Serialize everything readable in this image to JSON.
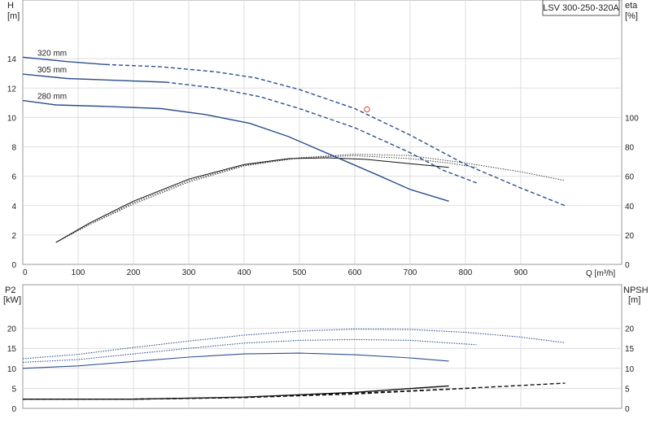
{
  "chart_data": [
    {
      "type": "line",
      "panel": "head-efficiency",
      "title": "LSV 300-250-320A",
      "ylabel": "H",
      "yunit": "[m]",
      "y2label": "eta",
      "y2unit": "[%]",
      "xlabel": "Q [m³/h]",
      "xlim": [
        0,
        1000
      ],
      "ylim": [
        0,
        16
      ],
      "y2lim": [
        0,
        140
      ],
      "xticks": [
        "0",
        "100",
        "200",
        "300",
        "400",
        "500",
        "600",
        "700",
        "800",
        "900"
      ],
      "yticks": [
        "0",
        "2",
        "4",
        "6",
        "8",
        "10",
        "12",
        "14"
      ],
      "y2ticks": [
        "0",
        "20",
        "40",
        "60",
        "80",
        "100"
      ],
      "grid": true,
      "head_curves": [
        {
          "name": "320 mm",
          "color": "#2b4f8f",
          "solid": [
            [
              0,
              14.1
            ],
            [
              80,
              13.8
            ],
            [
              150,
              13.6
            ]
          ],
          "dashed": [
            [
              150,
              13.6
            ],
            [
              250,
              13.45
            ],
            [
              350,
              13.1
            ],
            [
              420,
              12.7
            ],
            [
              500,
              11.9
            ],
            [
              600,
              10.6
            ],
            [
              700,
              8.8
            ],
            [
              800,
              6.8
            ],
            [
              900,
              5.2
            ],
            [
              980,
              4.0
            ]
          ]
        },
        {
          "name": "305 mm",
          "color": "#2b4f8f",
          "solid": [
            [
              0,
              12.95
            ],
            [
              80,
              12.65
            ],
            [
              150,
              12.55
            ],
            [
              258,
              12.4
            ]
          ],
          "dashed": [
            [
              258,
              12.4
            ],
            [
              350,
              12.0
            ],
            [
              430,
              11.4
            ],
            [
              500,
              10.6
            ],
            [
              600,
              9.3
            ],
            [
              700,
              7.6
            ],
            [
              760,
              6.4
            ],
            [
              820,
              5.55
            ]
          ]
        },
        {
          "name": "280 mm",
          "color": "#2b4f8f",
          "solid": [
            [
              0,
              11.15
            ],
            [
              60,
              10.85
            ],
            [
              150,
              10.75
            ],
            [
              250,
              10.6
            ],
            [
              330,
              10.2
            ],
            [
              410,
              9.6
            ],
            [
              480,
              8.7
            ],
            [
              560,
              7.4
            ],
            [
              640,
              6.1
            ],
            [
              700,
              5.1
            ],
            [
              770,
              4.3
            ]
          ]
        }
      ],
      "efficiency_curves": [
        {
          "name": "eta 320 mm",
          "style": "dotted",
          "color": "#444444",
          "points": [
            [
              60,
              15
            ],
            [
              120,
              27
            ],
            [
              200,
              41
            ],
            [
              300,
              56
            ],
            [
              400,
              67
            ],
            [
              500,
              72.5
            ],
            [
              600,
              75
            ],
            [
              700,
              74
            ],
            [
              800,
              69
            ],
            [
              900,
              63
            ],
            [
              980,
              57
            ]
          ]
        },
        {
          "name": "eta 305 mm",
          "style": "dotted",
          "color": "#444444",
          "points": [
            [
              60,
              15
            ],
            [
              120,
              27
            ],
            [
              200,
              42
            ],
            [
              300,
              57
            ],
            [
              400,
              67.5
            ],
            [
              500,
              72.5
            ],
            [
              600,
              74
            ],
            [
              700,
              72
            ],
            [
              770,
              69
            ],
            [
              820,
              66
            ]
          ]
        },
        {
          "name": "eta 280 mm",
          "style": "solid",
          "color": "#111111",
          "points": [
            [
              60,
              15
            ],
            [
              120,
              28
            ],
            [
              200,
              43
            ],
            [
              300,
              58
            ],
            [
              400,
              68
            ],
            [
              480,
              72
            ],
            [
              550,
              72.5
            ],
            [
              620,
              71.5
            ],
            [
              700,
              68.5
            ],
            [
              770,
              66
            ]
          ]
        }
      ],
      "duty_point": {
        "x": 622,
        "y": 10.55,
        "color": "#e23b3b"
      },
      "curve_labels": [
        "320 mm",
        "305 mm",
        "280 mm"
      ]
    },
    {
      "type": "line",
      "panel": "power-npsh",
      "ylabel": "P2",
      "yunit": "[kW]",
      "y2label": "NPSH",
      "y2unit": "[m]",
      "xlim": [
        0,
        1000
      ],
      "ylim": [
        0,
        25
      ],
      "y2lim": [
        0,
        25
      ],
      "yticks": [
        "0",
        "5",
        "10",
        "15",
        "20"
      ],
      "y2ticks": [
        "0",
        "5",
        "10",
        "15",
        "20"
      ],
      "grid": true,
      "power_curves": [
        {
          "name": "P2 320 mm",
          "style": "dotted",
          "color": "#2b4f8f",
          "points": [
            [
              0,
              12.4
            ],
            [
              100,
              13.5
            ],
            [
              200,
              15.2
            ],
            [
              300,
              16.8
            ],
            [
              400,
              18.3
            ],
            [
              500,
              19.3
            ],
            [
              600,
              19.8
            ],
            [
              700,
              19.7
            ],
            [
              800,
              19.0
            ],
            [
              900,
              17.8
            ],
            [
              980,
              16.4
            ]
          ]
        },
        {
          "name": "P2 305 mm",
          "style": "dotted",
          "color": "#2b4f8f",
          "points": [
            [
              0,
              11.5
            ],
            [
              100,
              12.2
            ],
            [
              200,
              13.6
            ],
            [
              300,
              15.0
            ],
            [
              400,
              16.3
            ],
            [
              500,
              17.0
            ],
            [
              600,
              17.2
            ],
            [
              700,
              17.0
            ],
            [
              820,
              15.9
            ]
          ]
        },
        {
          "name": "P2 280 mm",
          "style": "solid",
          "color": "#2b4f8f",
          "points": [
            [
              0,
              10.0
            ],
            [
              100,
              10.6
            ],
            [
              200,
              11.7
            ],
            [
              300,
              12.8
            ],
            [
              400,
              13.6
            ],
            [
              500,
              13.8
            ],
            [
              600,
              13.4
            ],
            [
              700,
              12.6
            ],
            [
              770,
              11.8
            ]
          ]
        }
      ],
      "npsh_curves": [
        {
          "name": "NPSH 320 mm",
          "style": "dashed",
          "color": "#111111",
          "points": [
            [
              0,
              2.3
            ],
            [
              200,
              2.3
            ],
            [
              400,
              2.7
            ],
            [
              600,
              3.6
            ],
            [
              800,
              5.0
            ],
            [
              980,
              6.3
            ]
          ]
        },
        {
          "name": "NPSH 305 mm",
          "style": "dashed",
          "color": "#111111",
          "points": [
            [
              0,
              2.3
            ],
            [
              200,
              2.3
            ],
            [
              400,
              2.7
            ],
            [
              600,
              3.8
            ],
            [
              820,
              5.1
            ]
          ]
        },
        {
          "name": "NPSH 280 mm",
          "style": "solid",
          "color": "#111111",
          "points": [
            [
              0,
              2.3
            ],
            [
              200,
              2.3
            ],
            [
              400,
              2.8
            ],
            [
              600,
              4.0
            ],
            [
              770,
              5.6
            ]
          ]
        }
      ]
    }
  ]
}
